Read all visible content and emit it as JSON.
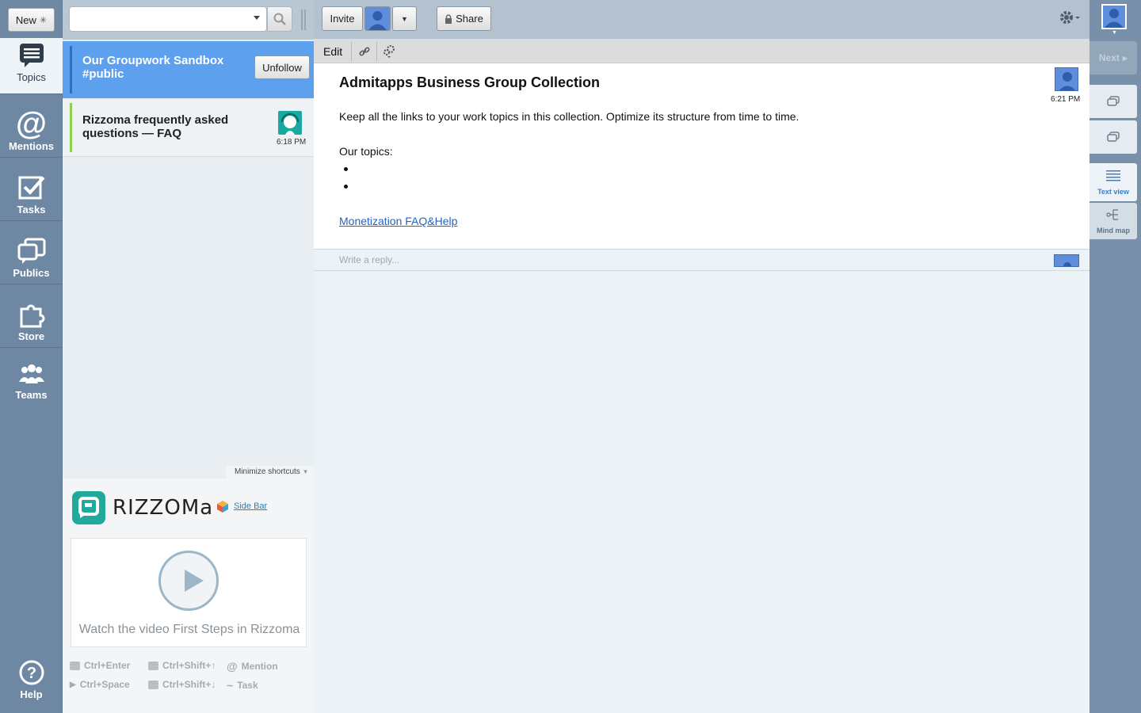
{
  "leftnav": {
    "new_label": "New",
    "items": [
      {
        "label": "Topics",
        "icon": "topics-icon"
      },
      {
        "label": "Mentions",
        "icon": "at-icon"
      },
      {
        "label": "Tasks",
        "icon": "checkbox-icon"
      },
      {
        "label": "Publics",
        "icon": "publics-icon"
      },
      {
        "label": "Store",
        "icon": "puzzle-icon"
      },
      {
        "label": "Teams",
        "icon": "team-icon"
      },
      {
        "label": "Help",
        "icon": "help-icon"
      }
    ]
  },
  "search": {
    "placeholder": ""
  },
  "topics": [
    {
      "title": "Our Groupwork Sandbox #public",
      "action": "Unfollow"
    },
    {
      "title": "Rizzoma frequently asked questions — FAQ",
      "time": "6:18 PM"
    }
  ],
  "promo": {
    "minimize_label": "Minimize shortcuts",
    "logo_text": "RIZZOMa",
    "sidebar_link": "Side Bar",
    "video_caption": "Watch the video First Steps in Rizzoma",
    "shortcuts": [
      {
        "keys": "Ctrl+Enter"
      },
      {
        "keys": "Ctrl+Shift+↑"
      },
      {
        "keys": "Mention"
      },
      {
        "keys": "Ctrl+Space"
      },
      {
        "keys": "Ctrl+Shift+↓"
      },
      {
        "keys": "Task"
      }
    ]
  },
  "toolbar": {
    "invite": "Invite",
    "share": "Share"
  },
  "editbar": {
    "edit": "Edit"
  },
  "doc": {
    "title": "Admitapps Business Group Collection",
    "time": "6:21 PM",
    "intro": "Keep all the links to your work topics in this collection. Optimize its structure from time to time.",
    "topics_label": "Our topics:",
    "link": "Monetization FAQ&Help"
  },
  "reply": {
    "placeholder": "Write a reply..."
  },
  "rightrail": {
    "next": "Next",
    "text_view": "Text view",
    "mind_map": "Mind map"
  },
  "colors": {
    "nav_bg": "#6e87a3",
    "active_topic": "#5da0ee",
    "accent_link": "#2563c4"
  }
}
